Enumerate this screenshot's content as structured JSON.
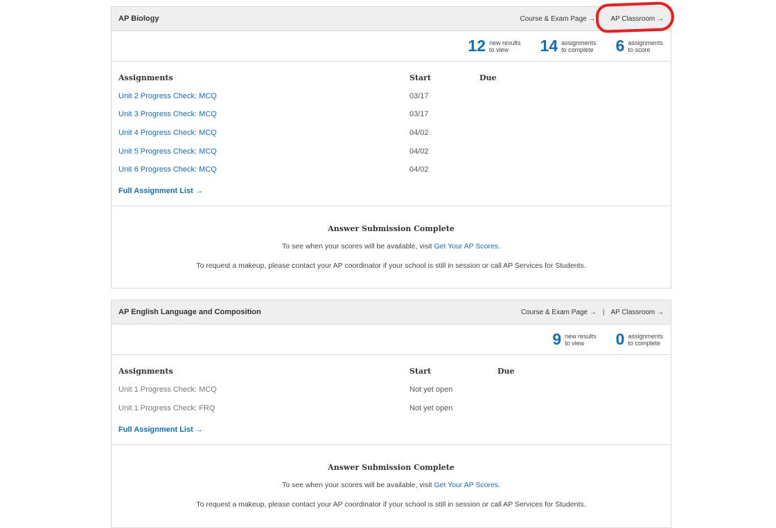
{
  "courses": [
    {
      "title": "AP Biology",
      "links": {
        "course_exam": "Course & Exam Page →",
        "separator": "",
        "classroom": "AP Classroom →"
      },
      "stats": [
        {
          "number": "12",
          "line1": "new results",
          "line2": "to view"
        },
        {
          "number": "14",
          "line1": "assignments",
          "line2": "to complete"
        },
        {
          "number": "6",
          "line1": "assignments",
          "line2": "to score"
        }
      ],
      "assignments": {
        "headers": {
          "name": "Assignments",
          "start": "Start",
          "due": "Due"
        },
        "rows": [
          {
            "name": "Unit 2 Progress Check: MCQ",
            "start": "03/17"
          },
          {
            "name": "Unit 3 Progress Check: MCQ",
            "start": "03/17"
          },
          {
            "name": "Unit 4 Progress Check: MCQ",
            "start": "04/02"
          },
          {
            "name": "Unit 5 Progress Check: MCQ",
            "start": "04/02"
          },
          {
            "name": "Unit 6 Progress Check: MCQ",
            "start": "04/02"
          }
        ],
        "full_list": "Full Assignment List →"
      },
      "notice": {
        "title": "Answer Submission Complete",
        "line1_prefix": "To see when your scores will be available, visit ",
        "line1_link": "Get Your AP Scores.",
        "line2": "To request a makeup, please contact your AP coordinator if your school is still in session or call AP Services for Students."
      }
    },
    {
      "title": "AP English Language and Composition",
      "links": {
        "course_exam": "Course & Exam Page →",
        "separator": "|",
        "classroom": "AP Classroom →"
      },
      "stats": [
        {
          "number": "9",
          "line1": "new results",
          "line2": "to view"
        },
        {
          "number": "0",
          "line1": "assignments",
          "line2": "to complete"
        }
      ],
      "assignments": {
        "headers": {
          "name": "Assignments",
          "start": "Start",
          "due": "Due"
        },
        "rows": [
          {
            "name": "Unit 1 Progress Check: MCQ",
            "start": "Not yet open"
          },
          {
            "name": "Unit 1 Progress Check: FRQ",
            "start": "Not yet open"
          }
        ],
        "full_list": "Full Assignment List →"
      },
      "notice": {
        "title": "Answer Submission Complete",
        "line1_prefix": "To see when your scores will be available, visit ",
        "line1_link": "Get Your AP Scores.",
        "line2": "To request a makeup, please contact your AP coordinator if your school is still in session or call AP Services for Students."
      }
    }
  ],
  "annotation": {
    "color": "#f01a1a",
    "target": "AP Classroom link (AP Biology)"
  }
}
